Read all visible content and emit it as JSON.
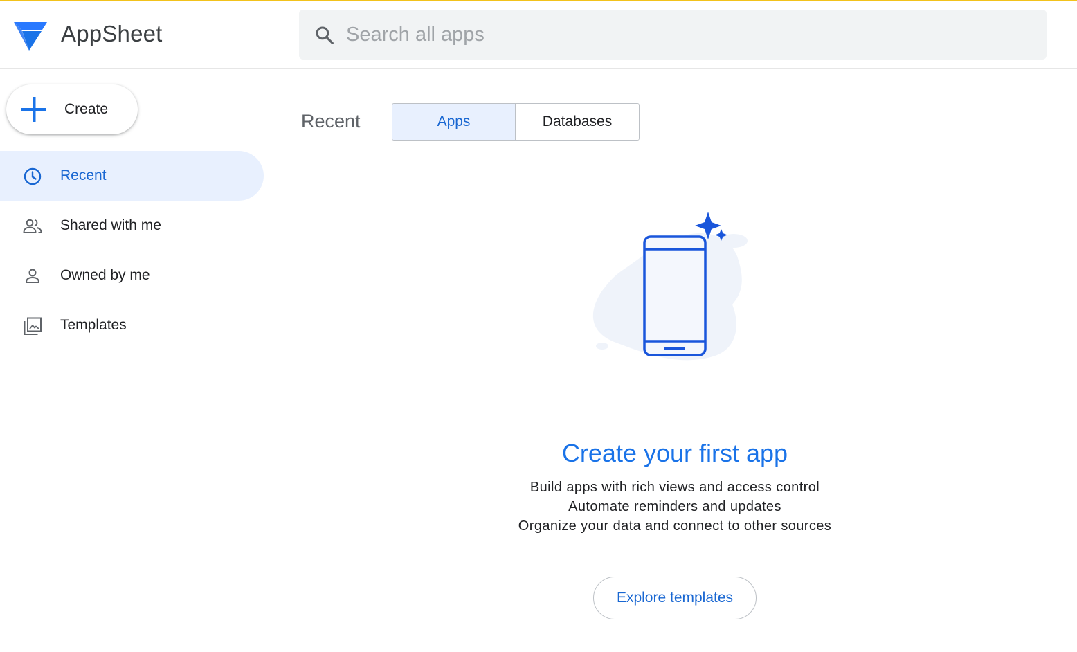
{
  "header": {
    "app_title": "AppSheet",
    "search_placeholder": "Search all apps"
  },
  "sidebar": {
    "create_label": "Create",
    "items": [
      {
        "label": "Recent",
        "icon": "clock-icon",
        "active": true
      },
      {
        "label": "Shared with me",
        "icon": "people-icon",
        "active": false
      },
      {
        "label": "Owned by me",
        "icon": "person-icon",
        "active": false
      },
      {
        "label": "Templates",
        "icon": "gallery-icon",
        "active": false
      }
    ]
  },
  "main": {
    "section_title": "Recent",
    "tabs": [
      {
        "label": "Apps",
        "selected": true
      },
      {
        "label": "Databases",
        "selected": false
      }
    ],
    "empty_state": {
      "title": "Create your first app",
      "lines": [
        "Build apps with rich views and access control",
        "Automate reminders and updates",
        "Organize your data and connect to other sources"
      ],
      "button_label": "Explore templates"
    }
  },
  "colors": {
    "accent": "#1a73e8",
    "active_bg": "#e8f0fe",
    "search_bg": "#f1f3f4",
    "top_line": "#f2c21b"
  }
}
